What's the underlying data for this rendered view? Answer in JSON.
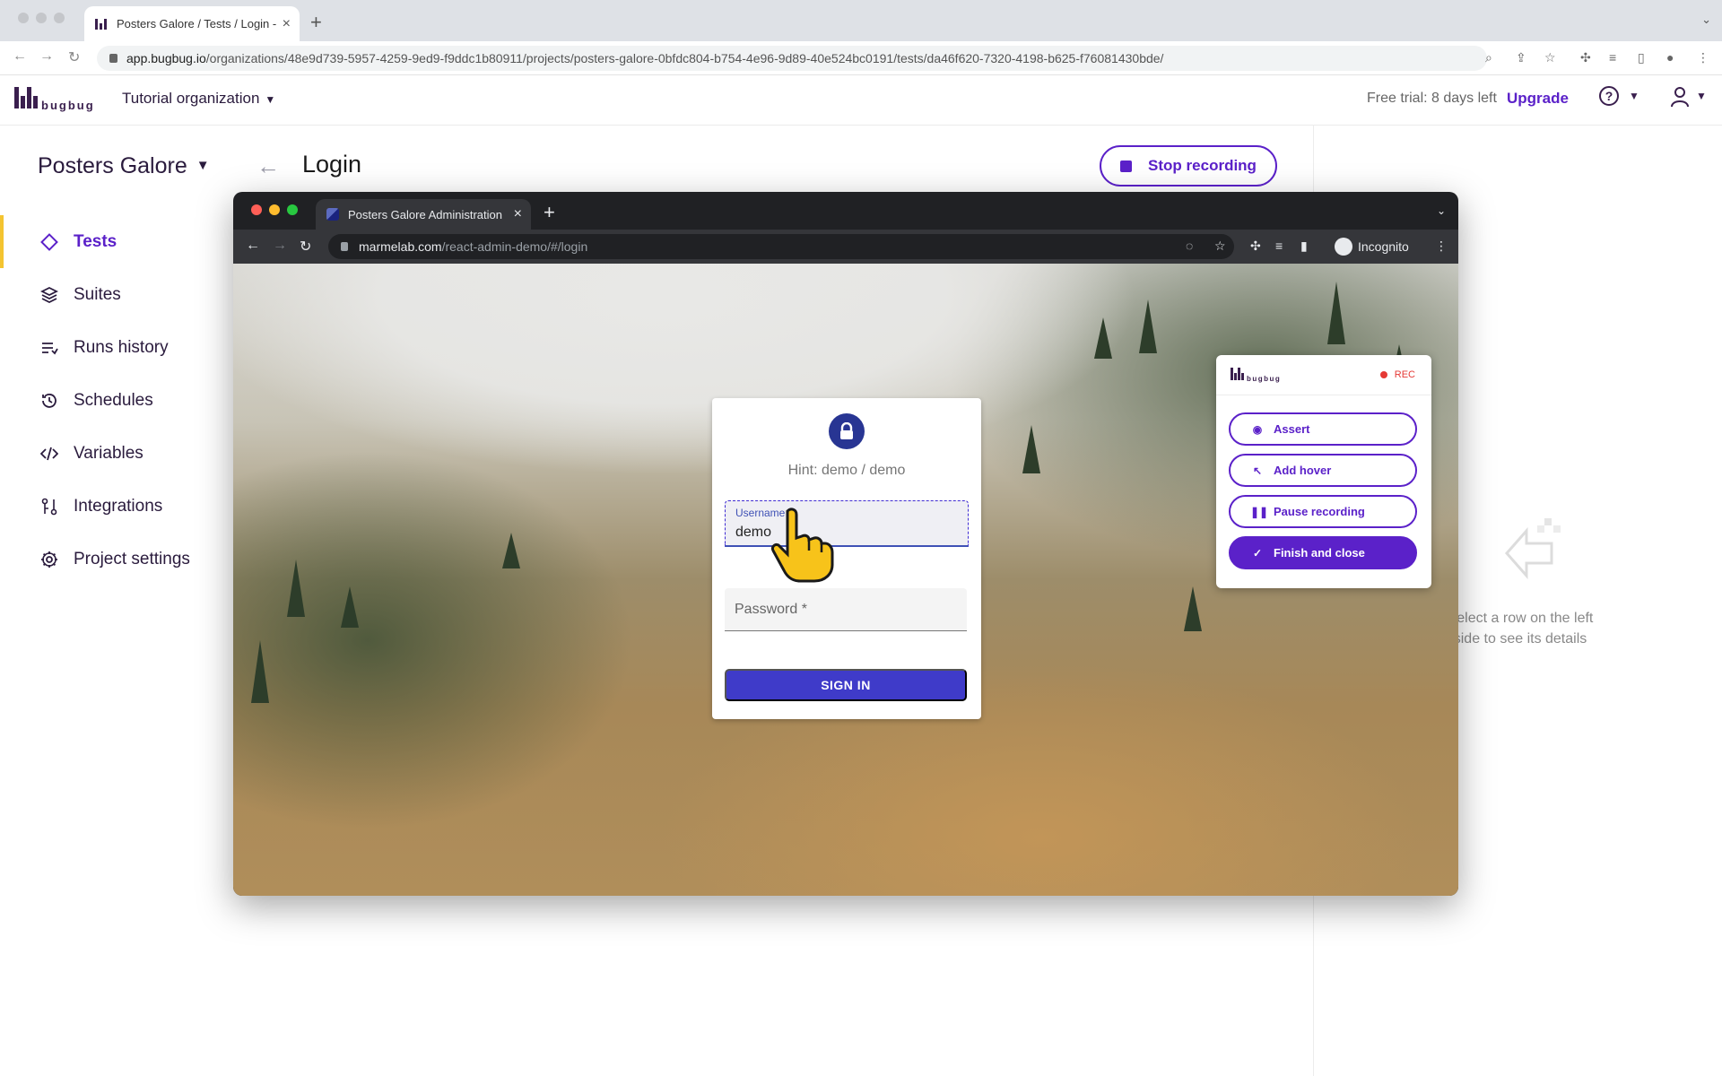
{
  "browser": {
    "tab_title": "Posters Galore / Tests / Login - BugBug",
    "url_host": "app.bugbug.io",
    "url_path": "/organizations/48e9d739-5957-4259-9ed9-f9ddc1b80911/projects/posters-galore-0bfdc804-b754-4e96-9d89-40e524bc0191/tests/da46f620-7320-4198-b625-f76081430bde/"
  },
  "header": {
    "logo_text": "bugbug",
    "organization": "Tutorial organization",
    "trial_text": "Free trial: 8 days left",
    "upgrade_label": "Upgrade",
    "help_glyph": "?"
  },
  "sidebar": {
    "project_name": "Posters Galore",
    "items": [
      {
        "label": "Tests",
        "icon": "diamond-icon",
        "active": true
      },
      {
        "label": "Suites",
        "icon": "layers-icon",
        "active": false
      },
      {
        "label": "Runs history",
        "icon": "list-icon",
        "active": false
      },
      {
        "label": "Schedules",
        "icon": "history-icon",
        "active": false
      },
      {
        "label": "Variables",
        "icon": "code-icon",
        "active": false
      },
      {
        "label": "Integrations",
        "icon": "integrations-icon",
        "active": false
      },
      {
        "label": "Project settings",
        "icon": "gear-icon",
        "active": false
      }
    ]
  },
  "main": {
    "title": "Login",
    "stop_recording_label": "Stop recording",
    "empty_hint": "Select a row on the left side to see its details"
  },
  "inner_browser": {
    "tab_title": "Posters Galore Administration",
    "url_host": "marmelab.com",
    "url_path": "/react-admin-demo/#/login",
    "incognito_label": "Incognito"
  },
  "login": {
    "hint": "Hint: demo / demo",
    "username_label": "Username *",
    "username_value": "demo",
    "password_label": "Password *",
    "signin_label": "SIGN IN"
  },
  "recorder": {
    "logo_text": "bugbug",
    "status": "REC",
    "buttons": {
      "assert": "Assert",
      "add_hover": "Add hover",
      "pause": "Pause recording",
      "finish": "Finish and close"
    }
  },
  "colors": {
    "brand_purple": "#5b21c9",
    "active_marker": "#f4c430",
    "rec_red": "#e53935"
  }
}
